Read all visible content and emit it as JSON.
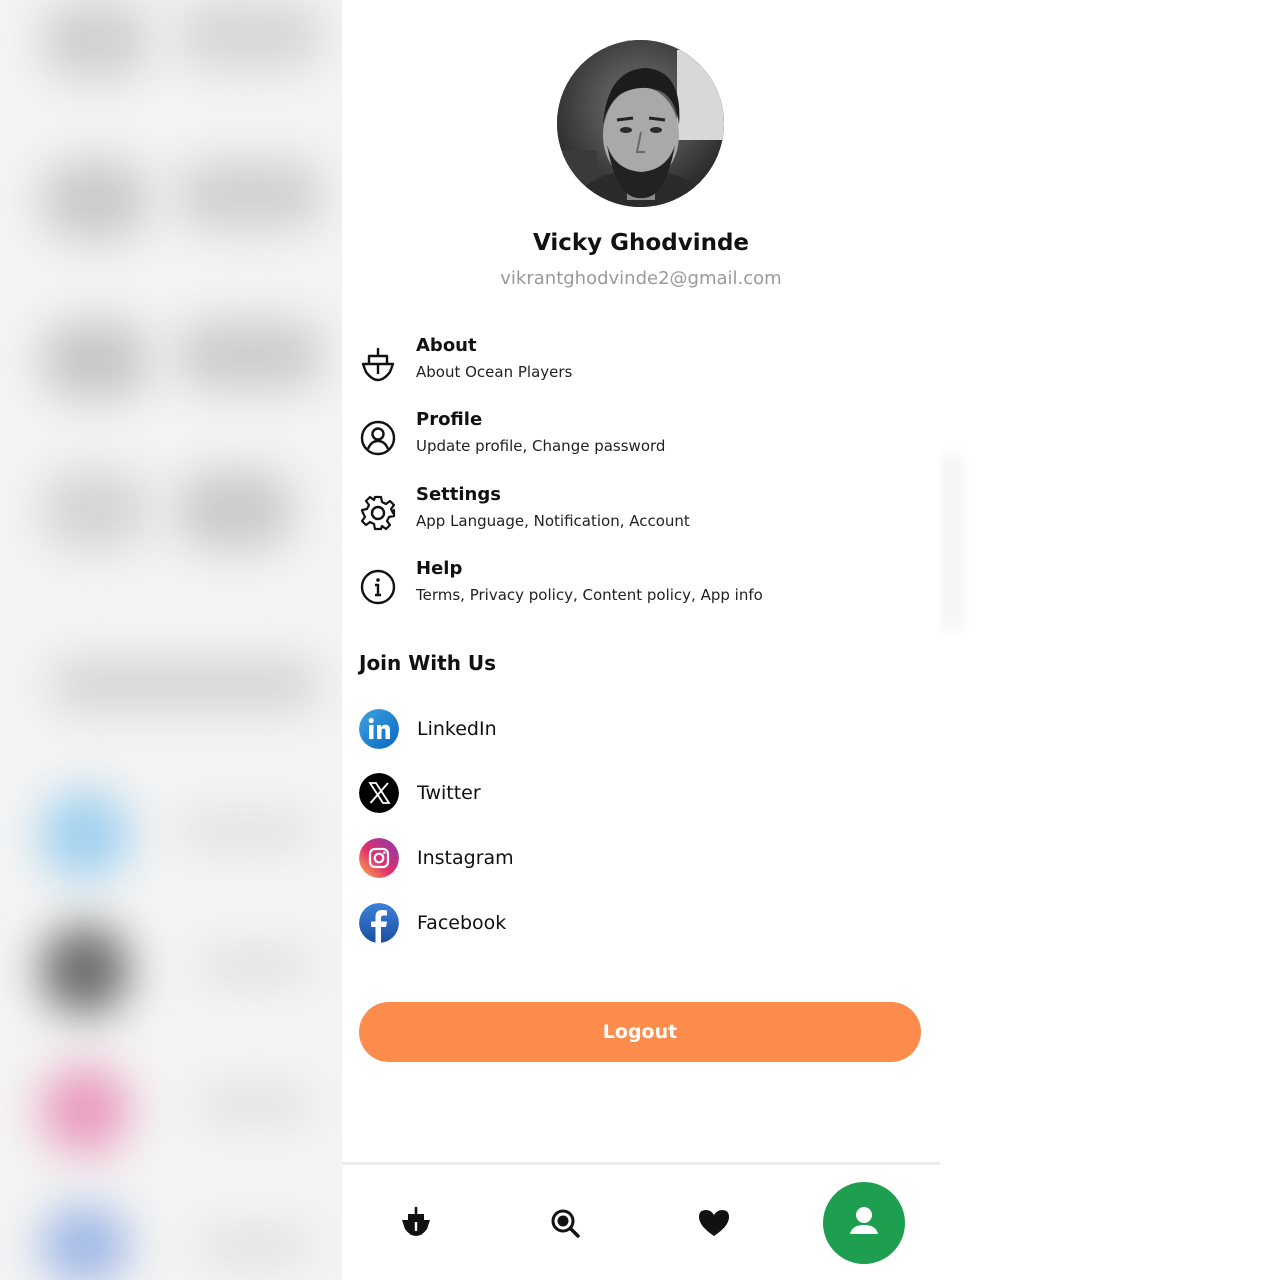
{
  "user": {
    "name": "Vicky Ghodvinde",
    "email": "vikrantghodvinde2@gmail.com"
  },
  "menu": [
    {
      "title": "About",
      "subtitle": "About Ocean Players",
      "icon": "ship-icon"
    },
    {
      "title": "Profile",
      "subtitle": "Update profile, Change password",
      "icon": "user-circle-icon"
    },
    {
      "title": "Settings",
      "subtitle": "App Language, Notification, Account",
      "icon": "gear-icon"
    },
    {
      "title": "Help",
      "subtitle": "Terms, Privacy policy, Content policy, App info",
      "icon": "info-icon"
    }
  ],
  "social": {
    "title": "Join With Us",
    "items": [
      {
        "label": "LinkedIn",
        "icon": "linkedin-icon"
      },
      {
        "label": "Twitter",
        "icon": "x-twitter-icon"
      },
      {
        "label": "Instagram",
        "icon": "instagram-icon"
      },
      {
        "label": "Facebook",
        "icon": "facebook-icon"
      }
    ]
  },
  "logout_label": "Logout",
  "bottom_nav": [
    {
      "name": "home",
      "icon": "ship-icon",
      "active": false
    },
    {
      "name": "search",
      "icon": "search-icon",
      "active": false
    },
    {
      "name": "favorites",
      "icon": "heart-icon",
      "active": false
    },
    {
      "name": "profile",
      "icon": "person-icon",
      "active": true
    }
  ],
  "colors": {
    "accent": "#fb8c4c",
    "active_nav": "#1e9e4f",
    "email_gray": "#9a9a9a"
  }
}
